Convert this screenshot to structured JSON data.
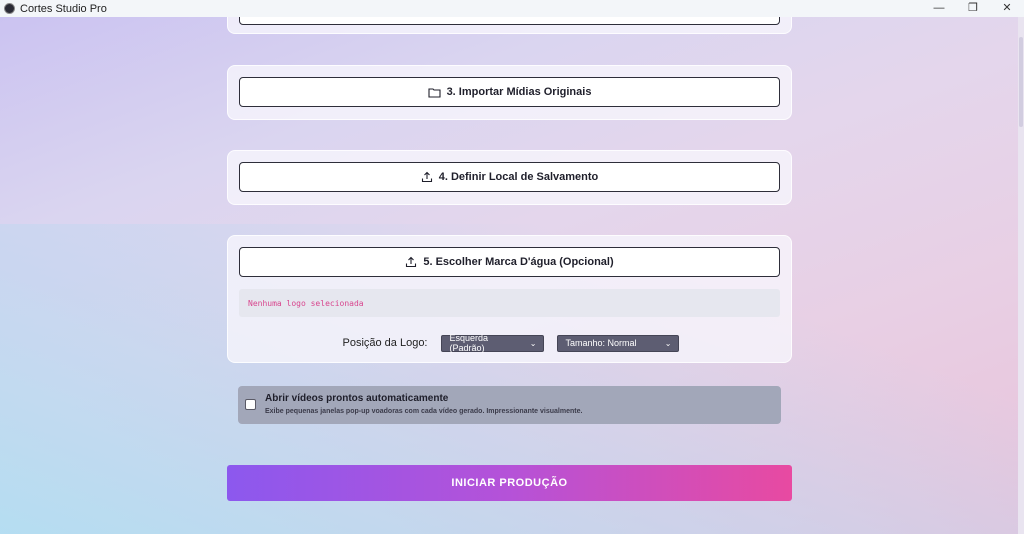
{
  "window": {
    "title": "Cortes Studio Pro",
    "minimize_glyph": "—",
    "maximize_glyph": "❐",
    "close_glyph": "✕"
  },
  "steps": {
    "import_media_label": "3. Importar Mídias Originais",
    "save_location_label": "4. Definir Local de Salvamento",
    "watermark_label": "5. Escolher Marca D'água (Opcional)"
  },
  "watermark": {
    "status_text": "Nenhuma logo selecionada",
    "position_label": "Posição da Logo:",
    "position_select": {
      "value": "Esquerda (Padrão)"
    },
    "size_select": {
      "value": "Tamanho: Normal"
    }
  },
  "auto_open": {
    "checked": false,
    "title": "Abrir vídeos prontos automaticamente",
    "description": "Exibe pequenas janelas pop-up voadoras com cada vídeo gerado. Impressionante visualmente."
  },
  "start_button_label": "INICIAR PRODUÇÃO",
  "icons": {
    "folder": "folder-icon",
    "upload": "upload-icon",
    "chevron": "chevron-down-icon"
  },
  "colors": {
    "status_text": "#d8468e",
    "start_gradient_from": "#8c58ee",
    "start_gradient_to": "#e84aa1",
    "select_bg": "#5d5d72"
  }
}
